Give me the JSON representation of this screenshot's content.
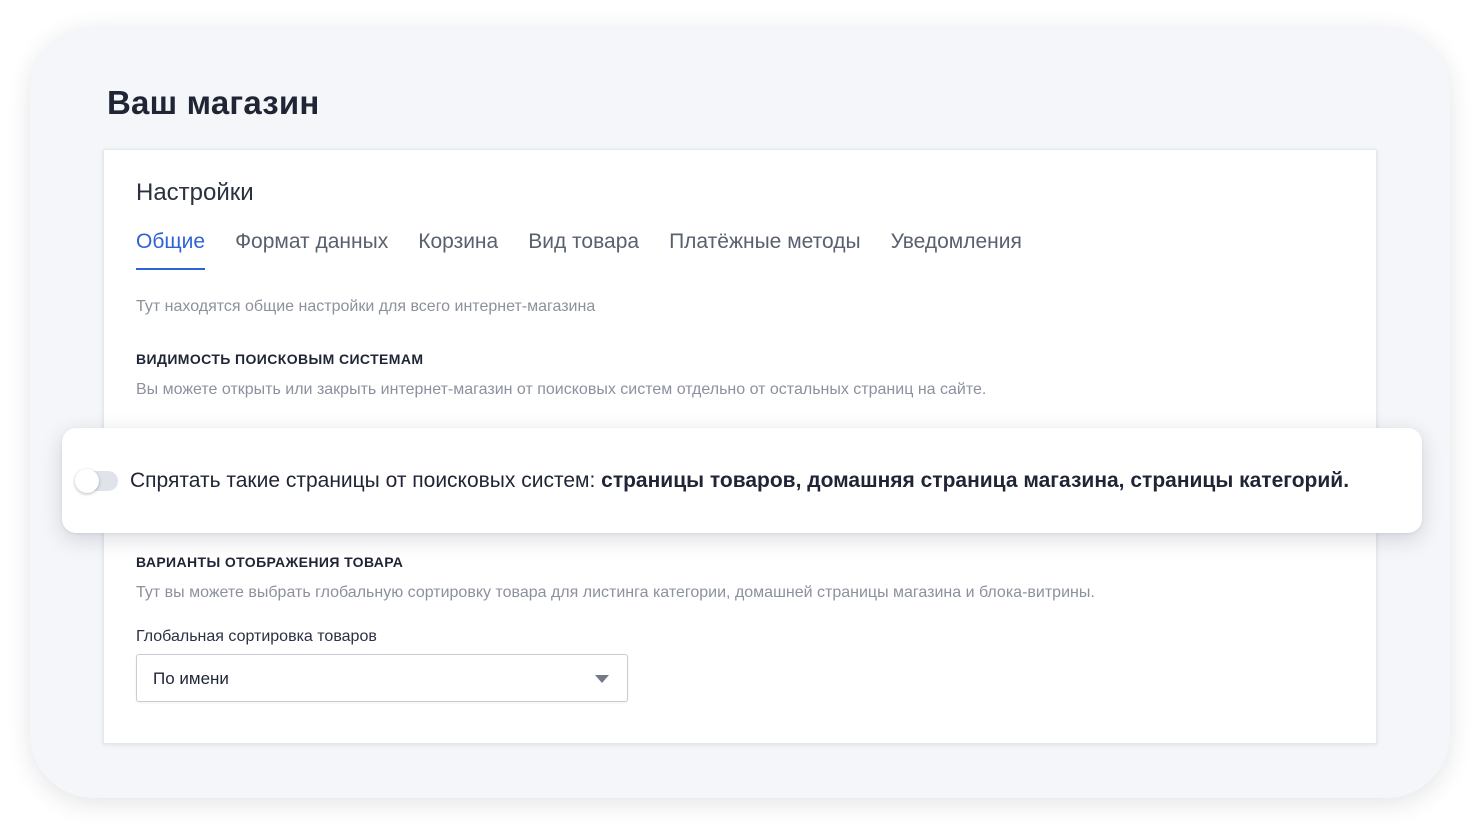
{
  "page": {
    "title": "Ваш магазин"
  },
  "settings": {
    "title": "Настройки",
    "tabs": [
      {
        "label": "Общие",
        "active": true
      },
      {
        "label": "Формат данных",
        "active": false
      },
      {
        "label": "Корзина",
        "active": false
      },
      {
        "label": "Вид товара",
        "active": false
      },
      {
        "label": "Платёжные методы",
        "active": false
      },
      {
        "label": "Уведомления",
        "active": false
      }
    ],
    "intro": "Тут находятся общие настройки для всего интернет-магазина"
  },
  "visibility": {
    "heading": "Видимость поисковым системам",
    "description": "Вы можете открыть или закрыть интернет-магазин от поисковых систем отдельно от остальных страниц на сайте.",
    "toggle": {
      "checked": false,
      "label_prefix": "Спрятать такие страницы от поисковых систем: ",
      "label_bold": "страницы товаров, домашняя страница магазина, страницы категорий."
    }
  },
  "display": {
    "heading": "Варианты отображения товара",
    "description": "Тут вы можете выбрать глобальную сортировку товара для листинга категории, домашней страницы магазина и блока-витрины.",
    "sort_label": "Глобальная сортировка товаров",
    "sort_value": "По имени"
  },
  "colors": {
    "accent": "#2e63d8",
    "text_primary": "#1f2534",
    "text_muted": "#8b919d"
  }
}
